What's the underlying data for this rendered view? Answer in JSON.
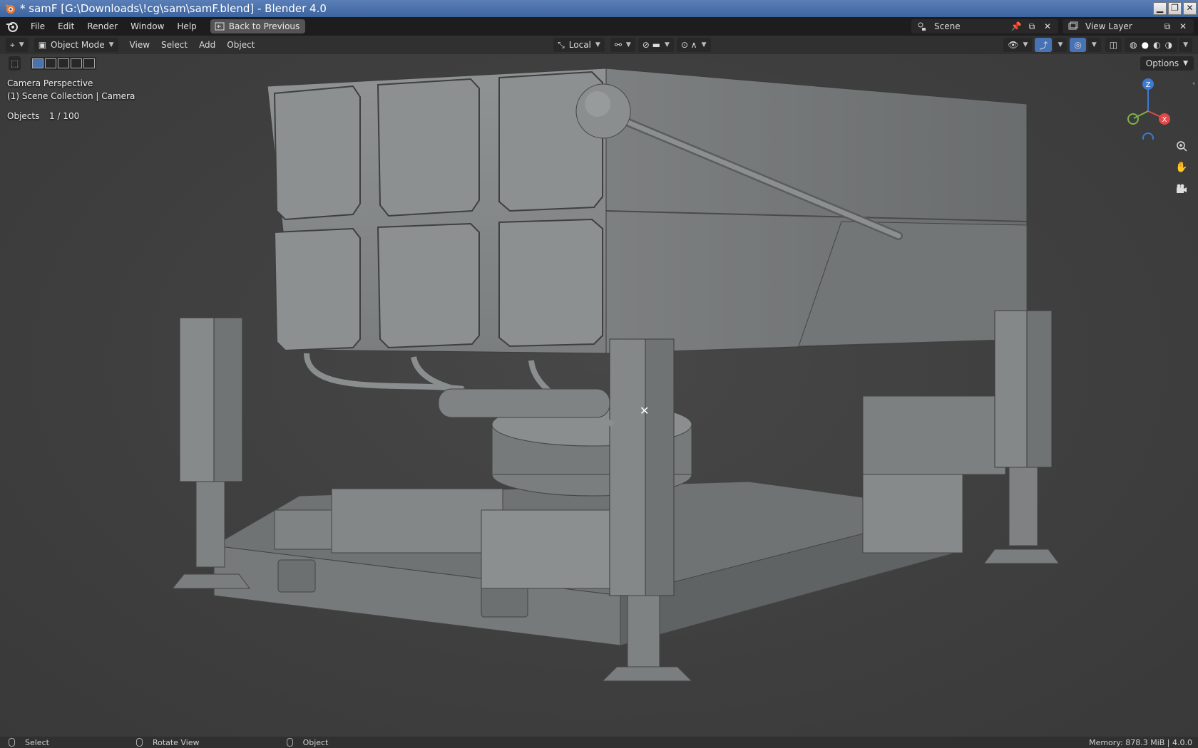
{
  "window": {
    "title": "* samF [G:\\Downloads\\!cg\\sam\\samF.blend] - Blender 4.0",
    "buttons": [
      "minimize",
      "restore",
      "close"
    ]
  },
  "topbar": {
    "menus": [
      "File",
      "Edit",
      "Render",
      "Window",
      "Help"
    ],
    "back_button": "Back to Previous",
    "scene": "Scene",
    "view_layer": "View Layer"
  },
  "viewport_header": {
    "mode": "Object Mode",
    "menus": [
      "View",
      "Select",
      "Add",
      "Object"
    ],
    "transform_orientation": "Local",
    "options": "Options"
  },
  "overlay": {
    "view_name": "Camera Perspective",
    "collection": "(1) Scene Collection | Camera",
    "objects_label": "Objects",
    "objects_value": "1 / 100"
  },
  "gizmo": {
    "z": "Z",
    "x": "X"
  },
  "statusbar": {
    "left": "Select",
    "middle": "Rotate View",
    "right": "Object",
    "memory": "Memory: 878.3 MiB | 4.0.0"
  },
  "colors": {
    "accent": "#4772b3",
    "title_bar": "#3d64a0",
    "axis_x": "#e04a4a",
    "axis_y": "#7fb24a",
    "axis_z": "#3a7bd5"
  }
}
